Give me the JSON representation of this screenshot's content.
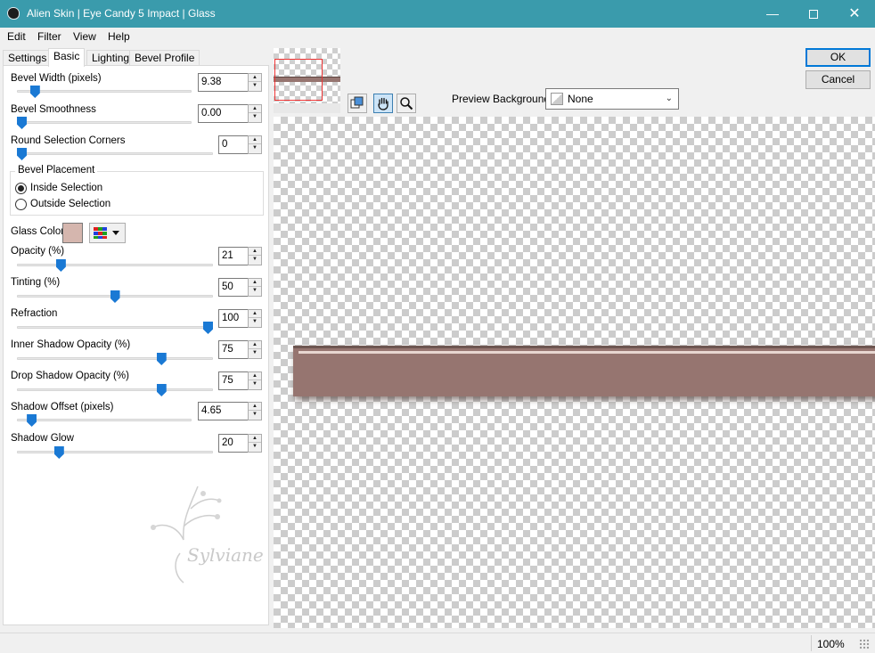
{
  "window": {
    "title": "Alien Skin | Eye Candy 5 Impact | Glass",
    "minimize": "—",
    "maximize": "",
    "close": "✕"
  },
  "menu": [
    "Edit",
    "Filter",
    "View",
    "Help"
  ],
  "tabs": [
    "Settings",
    "Basic",
    "Lighting",
    "Bevel Profile"
  ],
  "active_tab": "Basic",
  "controls": {
    "bevel_width": {
      "label": "Bevel Width (pixels)",
      "value": "9.38",
      "level": 0.08
    },
    "bevel_smoothness": {
      "label": "Bevel Smoothness",
      "value": "0.00",
      "level": 0.0
    },
    "round_corners": {
      "label": "Round Selection Corners",
      "value": "0",
      "level": 0.0
    },
    "opacity": {
      "label": "Opacity (%)",
      "value": "21",
      "level": 0.21
    },
    "tinting": {
      "label": "Tinting (%)",
      "value": "50",
      "level": 0.5
    },
    "refraction": {
      "label": "Refraction",
      "value": "100",
      "level": 1.0
    },
    "inner_shadow": {
      "label": "Inner Shadow Opacity (%)",
      "value": "75",
      "level": 0.75
    },
    "drop_shadow": {
      "label": "Drop Shadow Opacity (%)",
      "value": "75",
      "level": 0.75
    },
    "shadow_offset": {
      "label": "Shadow Offset (pixels)",
      "value": "4.65",
      "level": 0.06
    },
    "shadow_glow": {
      "label": "Shadow Glow",
      "value": "20",
      "level": 0.2
    }
  },
  "bevel_placement": {
    "title": "Bevel Placement",
    "inside": "Inside Selection",
    "outside": "Outside Selection",
    "selected": "inside"
  },
  "glass_color": {
    "label": "Glass Color",
    "value": "#d5b6ae"
  },
  "watermark_text": "Sylviane",
  "preview_background": {
    "label": "Preview Background:",
    "value": "None"
  },
  "buttons": {
    "ok": "OK",
    "cancel": "Cancel"
  },
  "status": {
    "zoom": "100%"
  },
  "colors": {
    "titlebar": "#3a9bac",
    "accent": "#1a79d4",
    "glass_bar": "#967570"
  }
}
